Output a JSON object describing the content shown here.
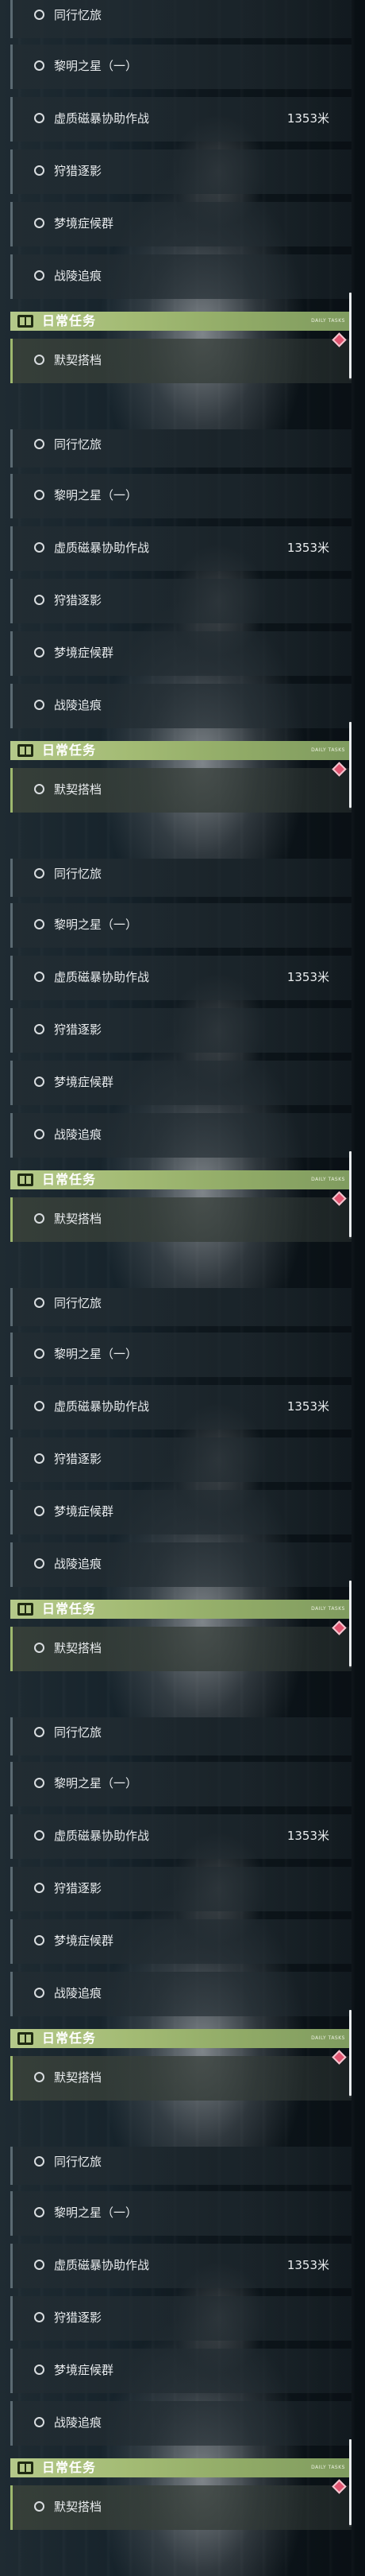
{
  "quests": [
    {
      "name": "同行忆旅",
      "distance": ""
    },
    {
      "name": "黎明之星（一）",
      "distance": ""
    },
    {
      "name": "虚质磁暴协助作战",
      "distance": "1353米"
    },
    {
      "name": "狩猎逐影",
      "distance": ""
    },
    {
      "name": "梦境症候群",
      "distance": ""
    },
    {
      "name": "战陵追痕",
      "distance": ""
    }
  ],
  "daily": {
    "title": "日常任务",
    "subtitle": "DAILY TASKS",
    "item": "默契搭档"
  },
  "colors": {
    "accent": "#a3bb74",
    "marker": "#e05470"
  },
  "icons": [
    "circle-icon",
    "book-icon",
    "diamond-marker-icon"
  ],
  "repeat_count": 6
}
